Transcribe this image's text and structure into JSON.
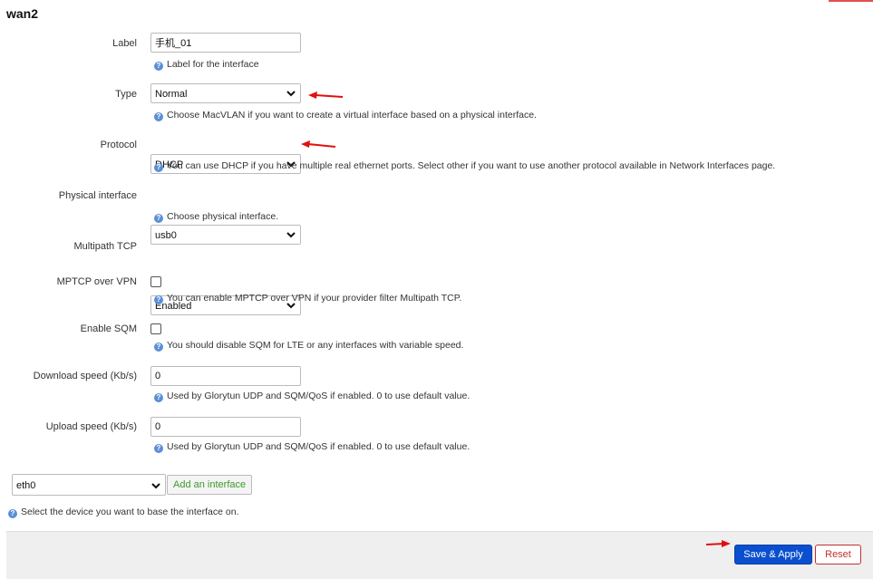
{
  "section_title": "wan2",
  "fields": {
    "label": {
      "label": "Label",
      "value": "手机_01",
      "help": "Label for the interface"
    },
    "type": {
      "label": "Type",
      "value": "Normal",
      "help": "Choose MacVLAN if you want to create a virtual interface based on a physical interface."
    },
    "protocol": {
      "label": "Protocol",
      "value": "DHCP",
      "help": "You can use DHCP if you have multiple real ethernet ports. Select other if you want to use another protocol available in Network Interfaces page."
    },
    "physical": {
      "label": "Physical interface",
      "value": "usb0",
      "help": "Choose physical interface."
    },
    "multipath": {
      "label": "Multipath TCP",
      "value": "Enabled"
    },
    "mptcp_vpn": {
      "label": "MPTCP over VPN",
      "checked": false,
      "help": "You can enable MPTCP over VPN if your provider filter Multipath TCP."
    },
    "sqm": {
      "label": "Enable SQM",
      "checked": false,
      "help": "You should disable SQM for LTE or any interfaces with variable speed."
    },
    "download": {
      "label": "Download speed (Kb/s)",
      "value": "0",
      "help": "Used by Glorytun UDP and SQM/QoS if enabled. 0 to use default value."
    },
    "upload": {
      "label": "Upload speed (Kb/s)",
      "value": "0",
      "help": "Used by Glorytun UDP and SQM/QoS if enabled. 0 to use default value."
    }
  },
  "add_interface": {
    "device_value": "eth0",
    "button_label": "Add an interface",
    "help": "Select the device you want to base the interface on."
  },
  "footer": {
    "apply_label": "Save & Apply",
    "reset_label": "Reset"
  },
  "colors": {
    "arrow": "#e01010",
    "primary": "#0a4fcf",
    "reset": "#c23030",
    "help_icon": "#5b8fd6",
    "add": "#3a9a2a"
  },
  "icons": {
    "help": "question-circle-icon",
    "dropdown": "chevron-down-icon",
    "annotation": "red-arrow-icon"
  }
}
